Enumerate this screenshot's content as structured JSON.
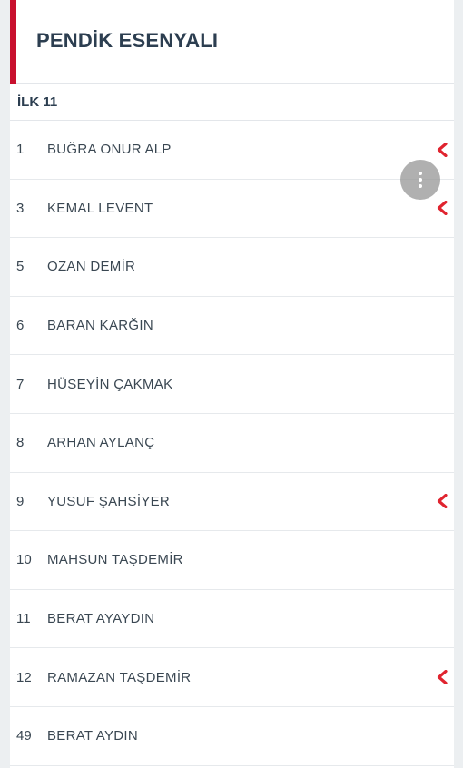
{
  "team": {
    "name": "PENDİK ESENYALI"
  },
  "lineup": {
    "section_title": "İLK 11",
    "players": [
      {
        "number": "1",
        "name": "BUĞRA ONUR ALP",
        "substituted": true
      },
      {
        "number": "3",
        "name": "KEMAL LEVENT",
        "substituted": true
      },
      {
        "number": "5",
        "name": "OZAN DEMİR",
        "substituted": false
      },
      {
        "number": "6",
        "name": "BARAN KARĞIN",
        "substituted": false
      },
      {
        "number": "7",
        "name": "HÜSEYİN ÇAKMAK",
        "substituted": false
      },
      {
        "number": "8",
        "name": "ARHAN AYLANÇ",
        "substituted": false
      },
      {
        "number": "9",
        "name": "YUSUF ŞAHSİYER",
        "substituted": true
      },
      {
        "number": "10",
        "name": "MAHSUN TAŞDEMİR",
        "substituted": false
      },
      {
        "number": "11",
        "name": "BERAT AYAYDIN",
        "substituted": false
      },
      {
        "number": "12",
        "name": "RAMAZAN TAŞDEMİR",
        "substituted": true
      },
      {
        "number": "49",
        "name": "BERAT AYDIN",
        "substituted": false
      }
    ]
  },
  "icons": {
    "substitution": "chevron-left-icon",
    "menu": "more-vertical-icon"
  },
  "colors": {
    "accent": "#c8102e",
    "text": "#2c3e50"
  }
}
